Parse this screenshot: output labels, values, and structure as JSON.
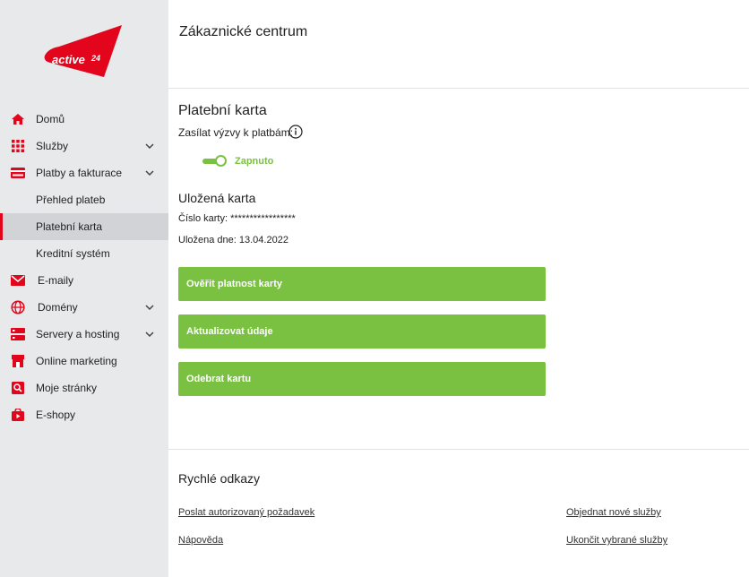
{
  "brand": {
    "logo_text": "active 24",
    "logo_color": "#e3051b"
  },
  "sidebar": {
    "items": [
      {
        "label": "Domů",
        "icon": "home-icon",
        "chevron": false
      },
      {
        "label": "Služby",
        "icon": "grid-icon",
        "chevron": true
      },
      {
        "label": "Platby a fakturace",
        "icon": "credit-card-icon",
        "chevron": true
      },
      {
        "label": "Přehled plateb",
        "sub": true
      },
      {
        "label": "Platební karta",
        "sub": true,
        "active": true
      },
      {
        "label": "Kreditní systém",
        "sub": true
      },
      {
        "label": "E-maily",
        "icon": "mail-icon",
        "chevron": false
      },
      {
        "label": "Domény",
        "icon": "globe-icon",
        "chevron": true
      },
      {
        "label": "Servery a hosting",
        "icon": "server-icon",
        "chevron": true
      },
      {
        "label": "Online marketing",
        "icon": "store-icon",
        "chevron": false
      },
      {
        "label": "Moje stránky",
        "icon": "web-search-icon",
        "chevron": false
      },
      {
        "label": "E-shopy",
        "icon": "shop-bag-icon",
        "chevron": false
      }
    ]
  },
  "header": {
    "title": "Zákaznické centrum"
  },
  "payment_card": {
    "title": "Platební karta",
    "notify_label": "Zasílat výzvy k platbám:",
    "toggle_state": "Zapnuto",
    "saved_card_title": "Uložená karta",
    "card_number": "Číslo karty: *****************",
    "saved_date": "Uložena dne: 13.04.2022",
    "buttons": {
      "verify": "Ověřit platnost karty",
      "update": "Aktualizovat údaje",
      "remove": "Odebrat kartu"
    }
  },
  "quick_links": {
    "title": "Rychlé odkazy",
    "links": [
      "Poslat autorizovaný požadavek",
      "Nápověda",
      "Objednat nové služby",
      "Ukončit vybrané služby"
    ]
  },
  "colors": {
    "accent_green": "#7ac142",
    "brand_red": "#e3051b",
    "sidebar_bg": "#e8e9eb"
  }
}
